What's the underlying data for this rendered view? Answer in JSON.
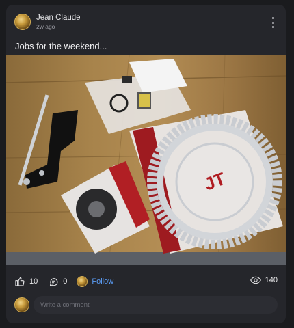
{
  "post": {
    "author": "Jean Claude",
    "time": "2w ago",
    "text": "Jobs for the weekend...",
    "image_alt": "Motorcycle sprockets and parts on a wooden table"
  },
  "actions": {
    "likes": "10",
    "comments": "0",
    "follow_label": "Follow",
    "views": "140"
  },
  "comment": {
    "placeholder": "Write a comment"
  },
  "icons": {
    "like": "thumbs-up-icon",
    "comment": "comment-icon",
    "views": "eye-icon",
    "menu": "more-vertical-icon"
  },
  "colors": {
    "background": "#1a1b1e",
    "card": "#25262b",
    "follow": "#5b9cf5"
  }
}
